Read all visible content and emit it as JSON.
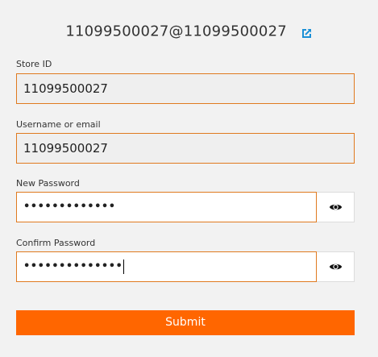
{
  "header": {
    "title": "11099500027@11099500027",
    "share_icon": "share-icon",
    "share_icon_color": "#1a8fd6"
  },
  "form": {
    "store_id": {
      "label": "Store ID",
      "value": "11099500027"
    },
    "username": {
      "label": "Username or email",
      "value": "11099500027"
    },
    "new_password": {
      "label": "New Password",
      "masked_value": "•••••••••••••",
      "toggle_icon": "eye-icon"
    },
    "confirm_password": {
      "label": "Confirm Password",
      "masked_value": "••••••••••••••",
      "toggle_icon": "eye-icon"
    },
    "submit_label": "Submit"
  },
  "colors": {
    "accent": "#ff6600",
    "field_border": "#e07a1f",
    "background": "#f2f2f2"
  }
}
